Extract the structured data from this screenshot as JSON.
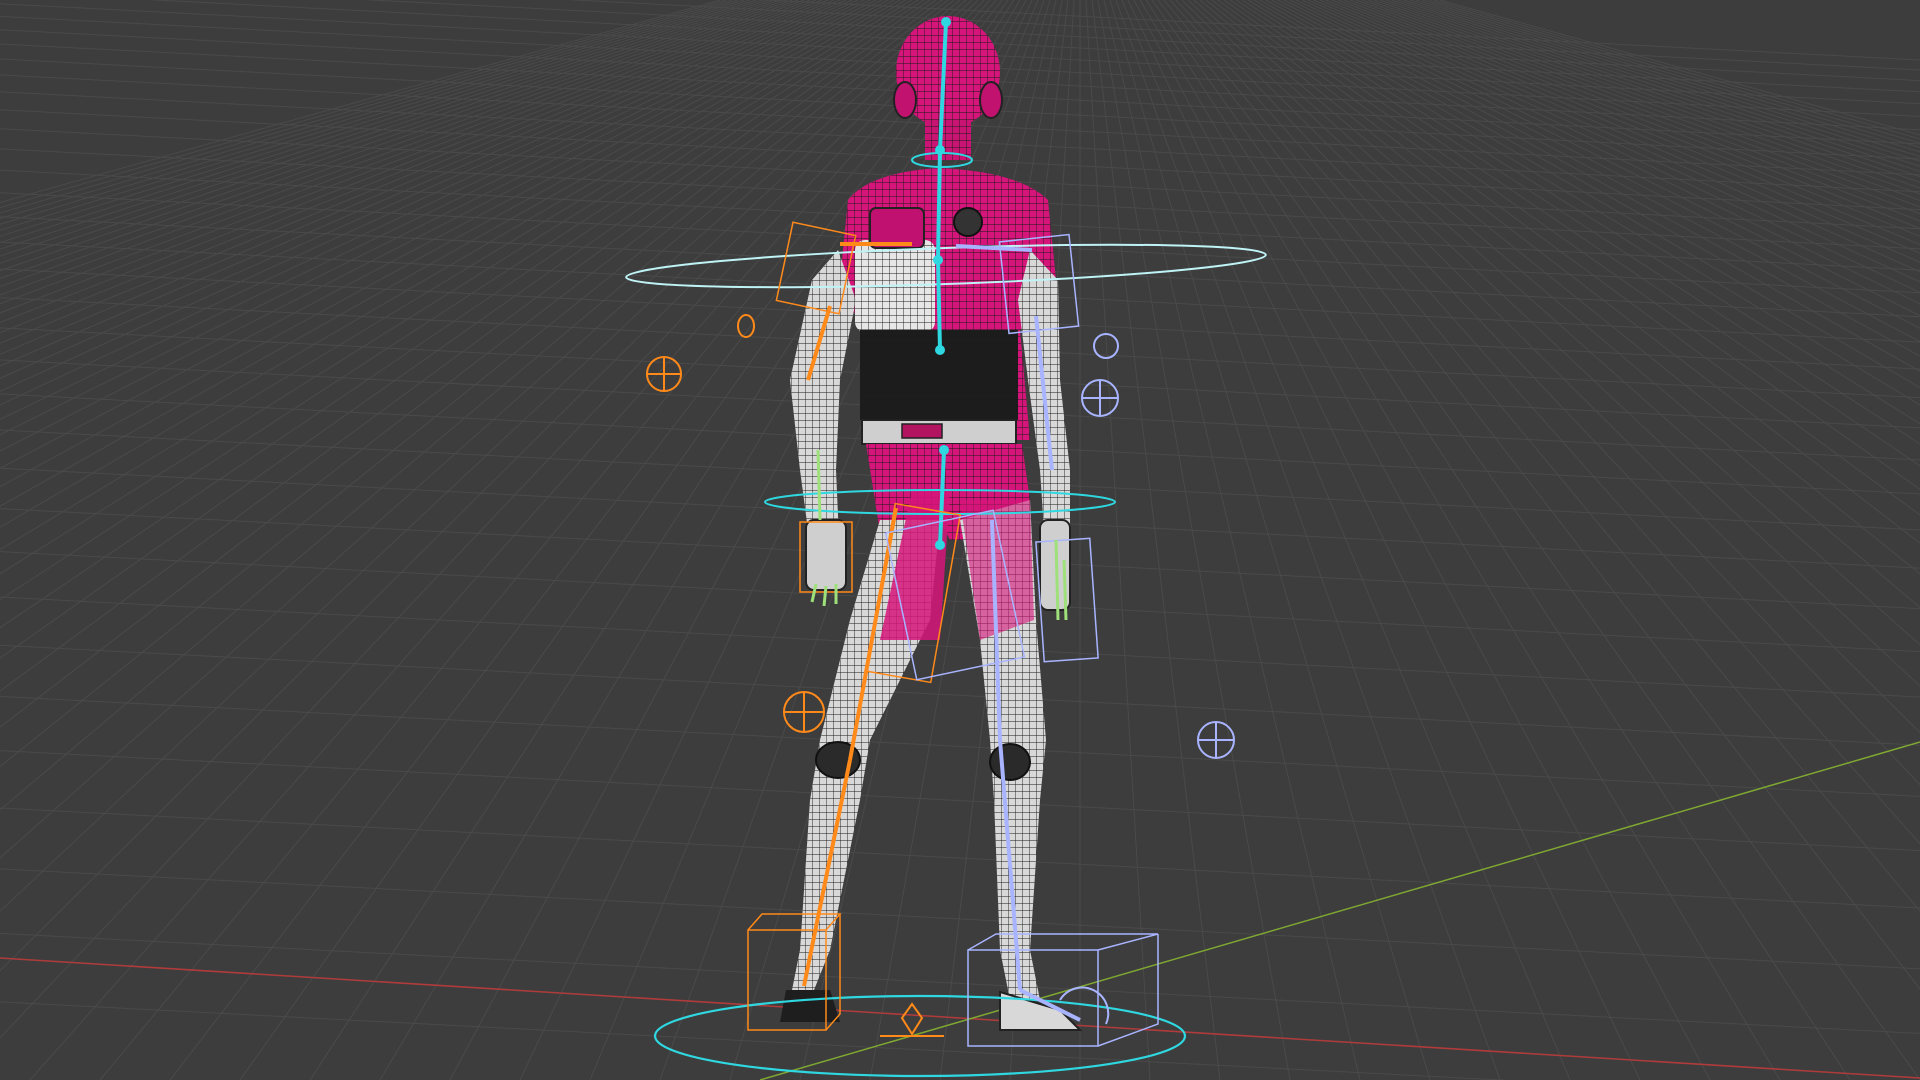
{
  "viewport": {
    "background": "#3d3d3d",
    "grid_color": "#4a4a4a",
    "axis_x_color": "#b03b3b",
    "axis_y_color": "#7fa832"
  },
  "character": {
    "mesh_wire_color": "#1a1a1a",
    "body_fill": "#d8d8d8",
    "accent_fill": "#d6157a",
    "harness_fill": "#1c1c1c",
    "icon": "humanoid-mesh-icon"
  },
  "rig": {
    "spine_color": "#2fd8e0",
    "left_side_color": "#ff8a1a",
    "right_side_color": "#a8b4ff",
    "finger_color": "#9ee07a",
    "controls": [
      "root-circle-control",
      "chest-ring-control",
      "hip-ring-control",
      "left-ik-foot-box",
      "right-ik-foot-box",
      "left-elbow-pole-target",
      "right-elbow-pole-target",
      "left-knee-pole-target",
      "right-knee-pole-target"
    ]
  }
}
